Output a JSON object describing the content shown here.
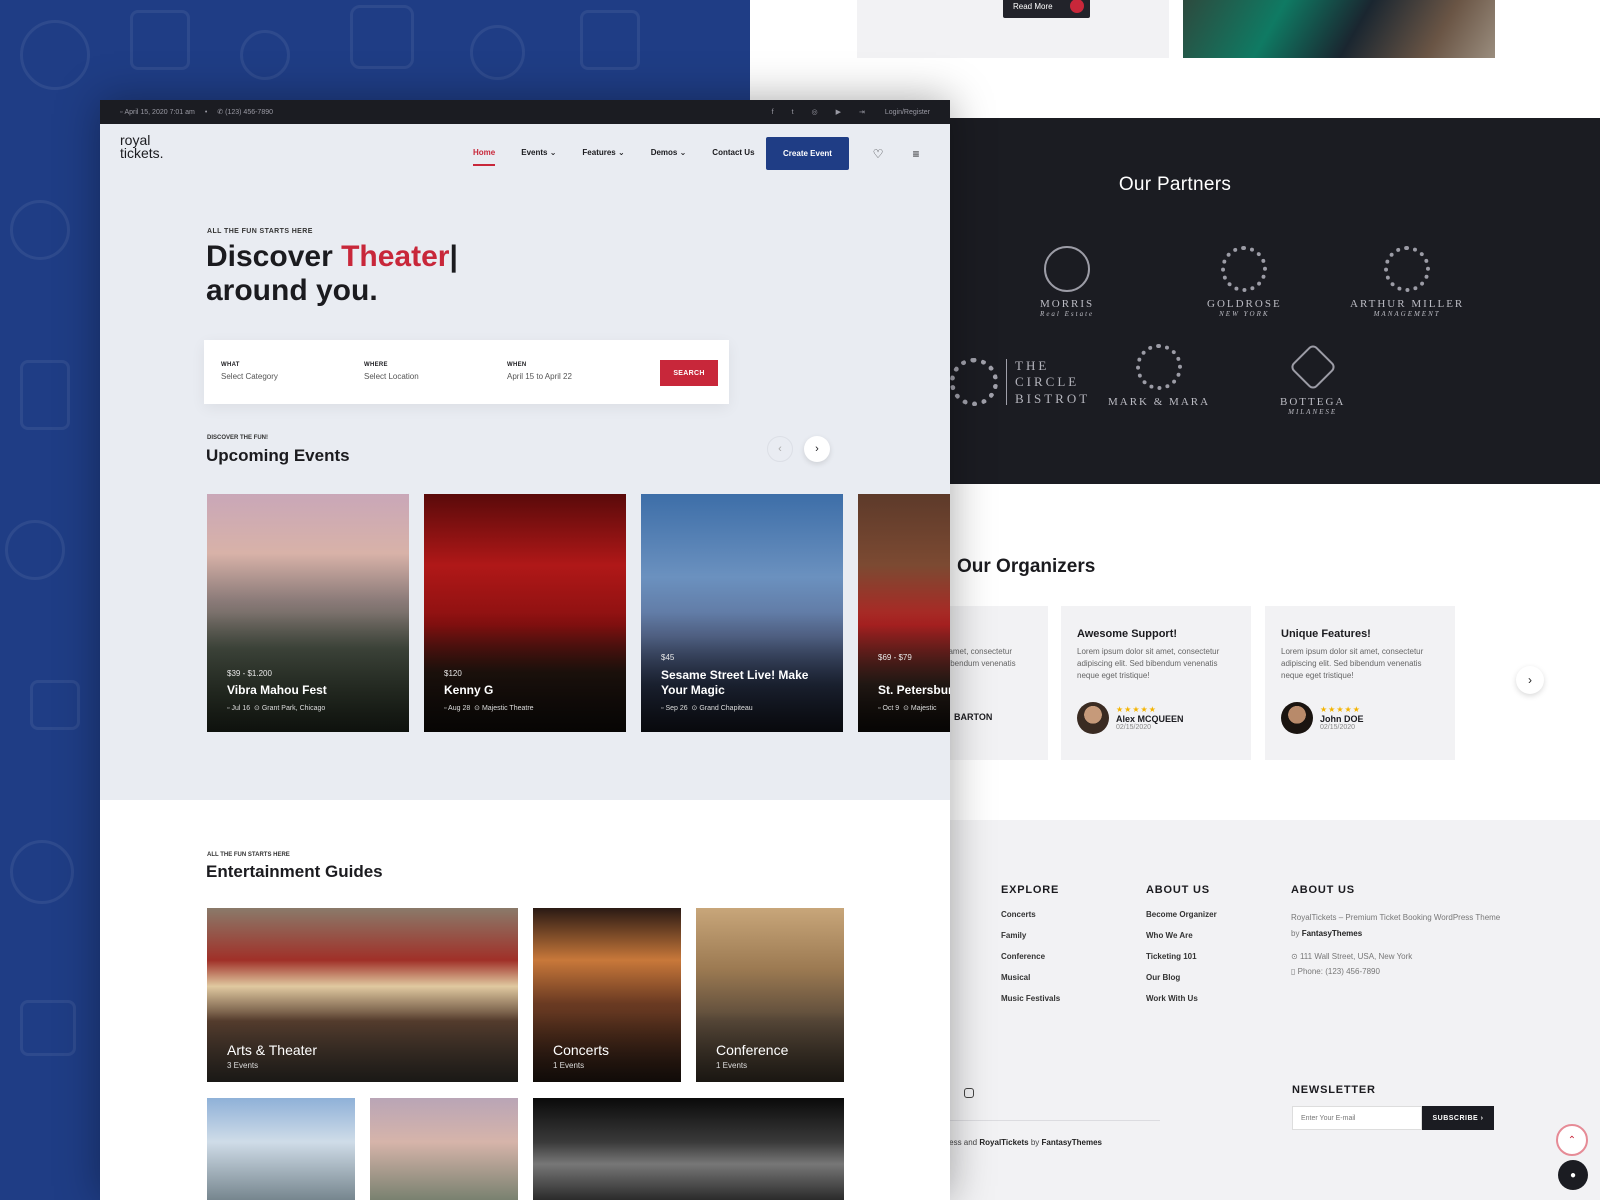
{
  "right_page": {
    "read_more": "Read More",
    "partners": {
      "title": "Our Partners",
      "logos": [
        {
          "name": "MORRIS",
          "sub": "Real Estate"
        },
        {
          "name": "GOLDROSE",
          "sub": "NEW YORK"
        },
        {
          "name": "ARTHUR MILLER",
          "sub": "MANAGEMENT"
        },
        {
          "name": "THE CIRCLE BISTROT",
          "sub": ""
        },
        {
          "name": "MARK & MARA",
          "sub": ""
        },
        {
          "name": "BOTTEGA",
          "sub": "MILANESE"
        }
      ],
      "circle_bistrot_lines": [
        "THE",
        "CIRCLE",
        "BISTROT"
      ]
    },
    "organizers": {
      "title": "Our Organizers",
      "cards": [
        {
          "title": "",
          "text": "t amet, consectetur bibendum venenatis",
          "name": "BARTON",
          "date": ""
        },
        {
          "title": "Awesome Support!",
          "text": "Lorem ipsum dolor sit amet, consectetur adipiscing elit. Sed bibendum venenatis neque eget tristique!",
          "name": "Alex MCQUEEN",
          "date": "02/15/2020",
          "stars": "★★★★★"
        },
        {
          "title": "Unique Features!",
          "text": "Lorem ipsum dolor sit amet, consectetur adipiscing elit. Sed bibendum venenatis neque eget tristique!",
          "name": "John DOE",
          "date": "02/15/2020",
          "stars": "★★★★★"
        }
      ]
    },
    "footer": {
      "explore": {
        "title": "EXPLORE",
        "links": [
          "Concerts",
          "Family",
          "Conference",
          "Musical",
          "Music Festivals"
        ]
      },
      "about_links": {
        "title": "ABOUT US",
        "links": [
          "Become Organizer",
          "Who We Are",
          "Ticketing 101",
          "Our Blog",
          "Work With Us"
        ]
      },
      "about_info": {
        "title": "ABOUT US",
        "desc": "RoyalTickets – Premium Ticket Booking WordPress Theme by",
        "desc_brand": "FantasyThemes",
        "address": "111 Wall Street, USA, New York",
        "phone": "Phone: (123) 456-7890"
      },
      "newsletter": {
        "title": "NEWSLETTER",
        "placeholder": "Enter Your E-mail",
        "button": "SUBSCRIBE"
      },
      "copyright_pre": "rdPress and",
      "copyright_brand1": "RoyalTickets",
      "copyright_by": "by",
      "copyright_brand2": "FantasyThemes"
    }
  },
  "front": {
    "topbar": {
      "date": "April 15, 2020 7:01 am",
      "phone": "(123) 456-7890",
      "login": "Login/Register"
    },
    "logo": {
      "line1": "royal",
      "line2": "tickets."
    },
    "nav": [
      {
        "label": "Home",
        "active": true
      },
      {
        "label": "Events ⌄"
      },
      {
        "label": "Features ⌄"
      },
      {
        "label": "Demos ⌄"
      },
      {
        "label": "Contact Us"
      }
    ],
    "create_event": "Create Event",
    "hero": {
      "kicker": "ALL THE FUN STARTS HERE",
      "title_pre": "Discover ",
      "title_accent": "Theater",
      "title_cursor": "|",
      "title_line2": "around you."
    },
    "search": {
      "what_label": "WHAT",
      "what_value": "Select Category",
      "where_label": "WHERE",
      "where_value": "Select Location",
      "when_label": "WHEN",
      "when_value": "April 15 to April 22",
      "button": "SEARCH"
    },
    "upcoming": {
      "kicker": "DISCOVER THE FUN!",
      "title": "Upcoming Events",
      "events": [
        {
          "price": "$39 - $1.200",
          "name": "Vibra Mahou Fest",
          "date": "Jul 16",
          "venue": "Grant Park, Chicago"
        },
        {
          "price": "$120",
          "name": "Kenny G",
          "date": "Aug 28",
          "venue": "Majestic Theatre"
        },
        {
          "price": "$45",
          "name": "Sesame Street Live! Make Your Magic",
          "date": "Sep 26",
          "venue": "Grand Chapiteau"
        },
        {
          "price": "$69 - $79",
          "name": "St. Petersburg Nutcracker",
          "date": "Oct 9",
          "venue": "Majestic"
        }
      ]
    },
    "guides": {
      "kicker": "ALL THE FUN STARTS HERE",
      "title": "Entertainment Guides",
      "items": [
        {
          "name": "Arts & Theater",
          "count": "3 Events"
        },
        {
          "name": "Concerts",
          "count": "1 Events"
        },
        {
          "name": "Conference",
          "count": "1 Events"
        }
      ]
    }
  }
}
